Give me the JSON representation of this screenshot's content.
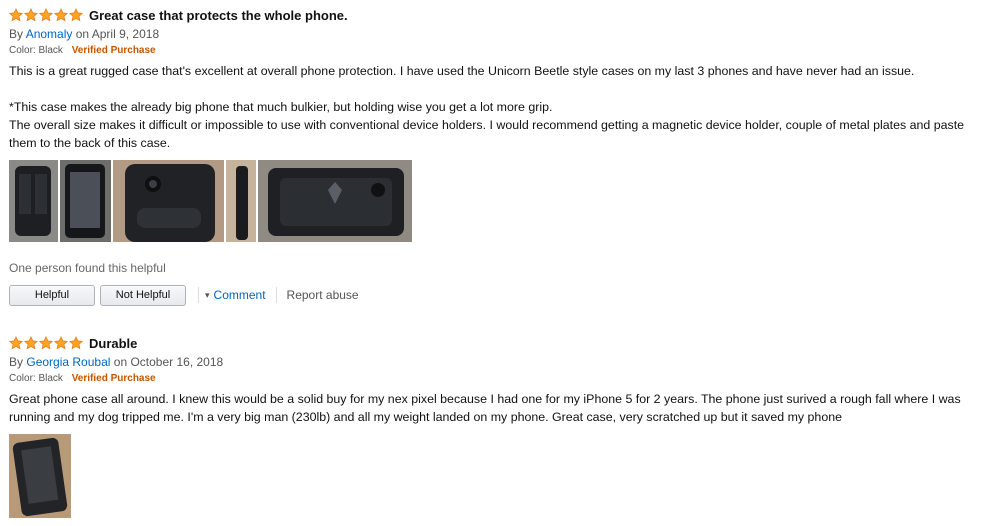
{
  "reviews": [
    {
      "rating": 5,
      "title": "Great case that protects the whole phone.",
      "by_prefix": "By",
      "author": "Anomaly",
      "date": "on April 9, 2018",
      "color": "Color: Black",
      "verified": "Verified Purchase",
      "paragraphs": [
        "This is a great rugged case that's excellent at overall phone protection. I have used the Unicorn Beetle style cases on my last 3 phones and have never had an issue.",
        "*This case makes the already big phone that much bulkier, but holding wise you get a lot more grip.",
        "The overall size makes it difficult or impossible to use with conventional device holders. I would recommend getting a magnetic device holder, couple of metal plates and paste them to the back of this case."
      ],
      "helpful_count_text": "One person found this helpful",
      "helpful_label": "Helpful",
      "not_helpful_label": "Not Helpful",
      "comment_label": "Comment",
      "report_label": "Report abuse"
    },
    {
      "rating": 5,
      "title": "Durable",
      "by_prefix": "By",
      "author": "Georgia Roubal",
      "date": "on October 16, 2018",
      "color": "Color: Black",
      "verified": "Verified Purchase",
      "paragraphs": [
        "Great phone case all around. I knew this would be a solid buy for my nex pixel because I had one for my iPhone 5 for 2 years. The phone just surived a rough fall where I was running and my dog tripped me. I'm a very big man (230lb) and all my weight landed on my phone. Great case, very scratched up but it saved my phone"
      ]
    }
  ],
  "colors": {
    "star": "#ffa41c",
    "link": "#0066c0",
    "verified": "#c45500"
  },
  "icons": {
    "star": "star-icon",
    "caret": "caret-down-icon"
  }
}
